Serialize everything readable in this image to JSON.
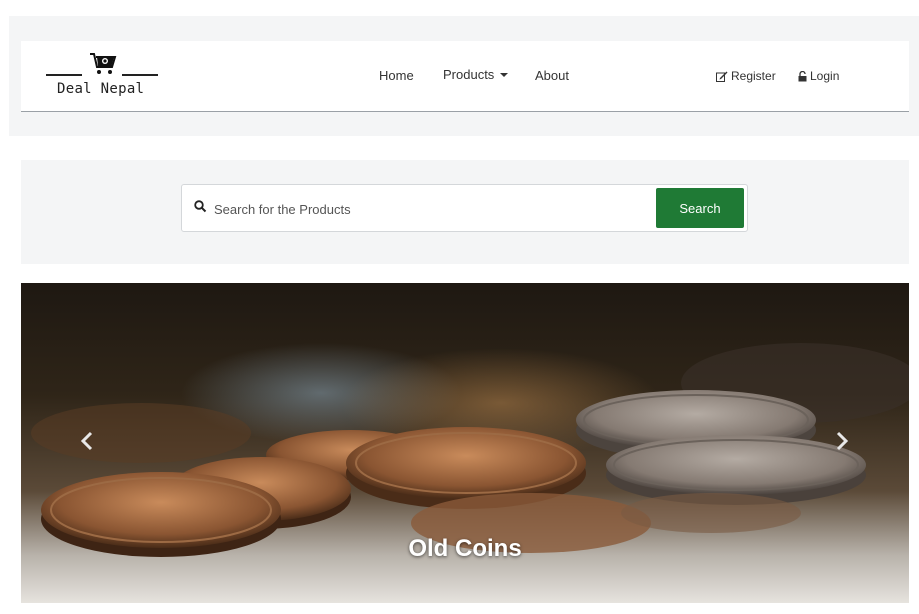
{
  "brand": {
    "logo_text": "Deal Nepal"
  },
  "nav": {
    "home_label": "Home",
    "products_label": "Products",
    "about_label": "About"
  },
  "auth": {
    "register_label": "Register",
    "login_label": "Login"
  },
  "search": {
    "placeholder": "Search for the Products",
    "value": "",
    "button_label": "Search"
  },
  "carousel": {
    "caption": "Old Coins",
    "prev_icon": "chevron-left-icon",
    "next_icon": "chevron-right-icon"
  },
  "colors": {
    "search_button": "#1f7a35",
    "panel_background": "#f4f5f6"
  }
}
